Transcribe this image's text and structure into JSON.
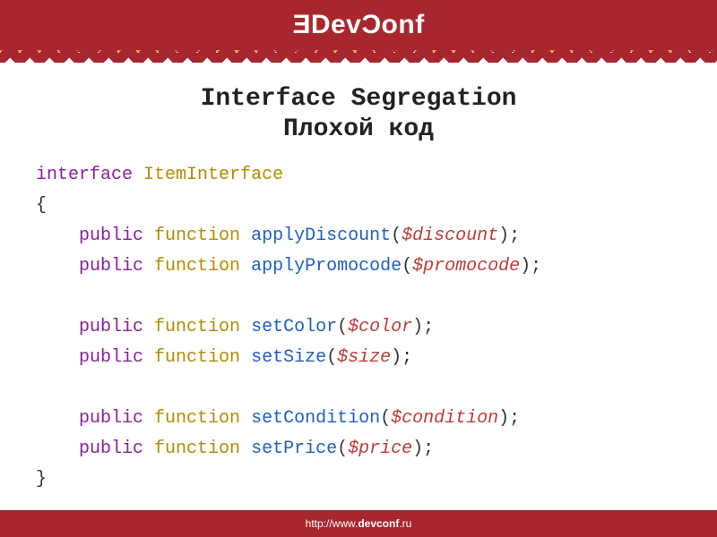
{
  "header": {
    "logo_text_1": "Dev",
    "logo_text_2": "onf"
  },
  "title": {
    "line1": "Interface Segregation",
    "line2": "Плохой код"
  },
  "code": {
    "kw_interface": "interface",
    "class_name": "ItemInterface",
    "brace_open": "{",
    "brace_close": "}",
    "kw_public": "public",
    "kw_function": "function",
    "m1": "applyDiscount",
    "v1": "$discount",
    "m2": "applyPromocode",
    "v2": "$promocode",
    "m3": "setColor",
    "v3": "$color",
    "m4": "setSize",
    "v4": "$size",
    "m5": "setCondition",
    "v5": "$condition",
    "m6": "setPrice",
    "v6": "$price",
    "paren_open": "(",
    "paren_close": ")",
    "semi": ";"
  },
  "footer": {
    "prefix": "http://www.",
    "bold": "devconf",
    "suffix": ".ru"
  }
}
